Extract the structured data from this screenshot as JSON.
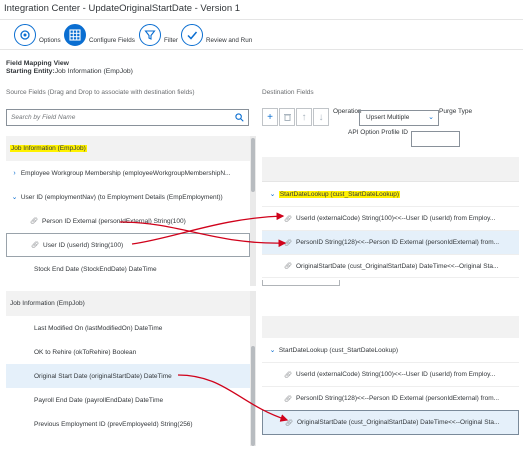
{
  "title": "Integration Center - UpdateOriginalStartDate - Version 1",
  "steps": [
    {
      "label": "Options",
      "icon": "options-icon"
    },
    {
      "label": "Configure Fields",
      "icon": "grid-icon"
    },
    {
      "label": "Filter",
      "icon": "filter-icon"
    },
    {
      "label": "Review and Run",
      "icon": "check-icon"
    }
  ],
  "view_title": "Field Mapping View",
  "starting_label": "Starting Entity:",
  "starting_value": "Job Information (EmpJob)",
  "source_header": "Source Fields (Drag and Drop to associate with destination fields)",
  "dest_header": "Destination Fields",
  "search_placeholder": "Search by Field Name",
  "operation_label": "Operation",
  "operation_value": "Upsert Multiple",
  "purge_label": "Purge Type",
  "api_label": "API Option Profile ID",
  "source_rows": [
    "Job Information (EmpJob)",
    "Employee Workgroup Membership (employeeWorkgroupMembershipN...",
    "User ID (employmentNav) (to Employment Details (EmpEmployment))",
    "Person ID External (personIdExternal) String(100)",
    "User ID (userId) String(100)",
    "Stock End Date (StockEndDate) DateTime",
    "Job Information (EmpJob)",
    "Last Modified On (lastModifiedOn) DateTime",
    "OK to Rehire (okToRehire) Boolean",
    "Original Start Date (originalStartDate) DateTime",
    "Payroll End Date (payrollEndDate) DateTime",
    "Previous Employment ID (prevEmployeeId) String(256)"
  ],
  "dest_top": [
    "StartDateLookup (cust_StartDateLookup)",
    "UserId (externalCode) String(100)<<--User ID (userId) from Employ...",
    "PersonID String(128)<<--Person ID External (personIdExternal) from...",
    "OriginalStartDate (cust_OriginalStartDate) DateTime<<--Original Sta..."
  ],
  "dest_bottom": [
    "StartDateLookup (cust_StartDateLookup)",
    "UserId (externalCode) String(100)<<--User ID (userId) from Employ...",
    "PersonID String(128)<<--Person ID External (personIdExternal) from...",
    "OriginalStartDate (cust_OriginalStartDate) DateTime<<--Original Sta..."
  ]
}
